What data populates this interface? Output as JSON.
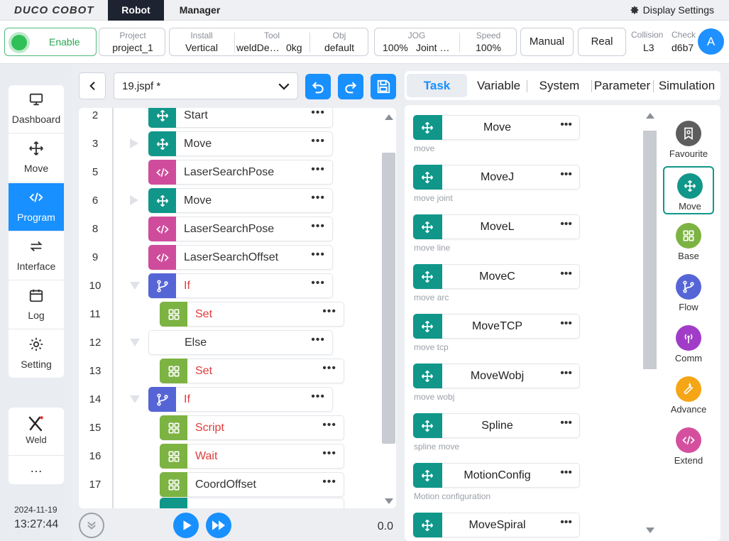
{
  "app": {
    "logo": "DUCO COBOT",
    "tabs": [
      "Robot",
      "Manager"
    ],
    "display_settings": "Display Settings"
  },
  "status": {
    "enable": "Enable",
    "project": {
      "caption": "Project",
      "value": "project_1"
    },
    "install": {
      "caption": "Install",
      "value": "Vertical"
    },
    "tool": {
      "caption": "Tool",
      "value": "weldDe…",
      "weight": "0kg"
    },
    "obj": {
      "caption": "Obj",
      "value": "default"
    },
    "jog": {
      "caption": "JOG",
      "percent": "100%",
      "mode": "Joint …"
    },
    "speed": {
      "caption": "Speed",
      "value": "100%"
    },
    "manual": "Manual",
    "real": "Real",
    "collision": {
      "caption": "Collision",
      "value": "L3"
    },
    "check": {
      "caption": "Check",
      "value": "d6b7"
    },
    "avatar": "A"
  },
  "sidebar": {
    "items": [
      {
        "label": "Dashboard",
        "icon": "monitor-icon"
      },
      {
        "label": "Move",
        "icon": "move-icon"
      },
      {
        "label": "Program",
        "icon": "code-icon"
      },
      {
        "label": "Interface",
        "icon": "swap-icon"
      },
      {
        "label": "Log",
        "icon": "calendar-icon"
      },
      {
        "label": "Setting",
        "icon": "gear-icon"
      }
    ],
    "active": "Program",
    "weld": "Weld",
    "more": "…"
  },
  "clock": {
    "date": "2024-11-19",
    "time": "13:27:44"
  },
  "program": {
    "file": "19.jspf *",
    "speed_value": "0.0",
    "rows": [
      {
        "line": "2",
        "label": "Start",
        "type": "move",
        "indent": 0,
        "arrow": "",
        "red": false
      },
      {
        "line": "3",
        "label": "Move",
        "type": "move",
        "indent": 0,
        "arrow": "right",
        "red": false
      },
      {
        "line": "5",
        "label": "LaserSearchPose",
        "type": "extend",
        "indent": 0,
        "arrow": "",
        "red": false
      },
      {
        "line": "6",
        "label": "Move",
        "type": "move",
        "indent": 0,
        "arrow": "right",
        "red": false
      },
      {
        "line": "8",
        "label": "LaserSearchPose",
        "type": "extend",
        "indent": 0,
        "arrow": "",
        "red": false
      },
      {
        "line": "9",
        "label": "LaserSearchOffset",
        "type": "extend",
        "indent": 0,
        "arrow": "",
        "red": false
      },
      {
        "line": "10",
        "label": "If",
        "type": "flow",
        "indent": 0,
        "arrow": "down",
        "red": true
      },
      {
        "line": "11",
        "label": "Set",
        "type": "base",
        "indent": 1,
        "arrow": "",
        "red": true
      },
      {
        "line": "12",
        "label": "Else",
        "type": "none",
        "indent": 0,
        "arrow": "down",
        "red": false
      },
      {
        "line": "13",
        "label": "Set",
        "type": "base",
        "indent": 1,
        "arrow": "",
        "red": true
      },
      {
        "line": "14",
        "label": "If",
        "type": "flow",
        "indent": 0,
        "arrow": "down",
        "red": true
      },
      {
        "line": "15",
        "label": "Script",
        "type": "base",
        "indent": 1,
        "arrow": "",
        "red": true
      },
      {
        "line": "16",
        "label": "Wait",
        "type": "base",
        "indent": 1,
        "arrow": "",
        "red": true
      },
      {
        "line": "17",
        "label": "CoordOffset",
        "type": "base",
        "indent": 1,
        "arrow": "",
        "red": false
      }
    ]
  },
  "right": {
    "tabs": [
      "Task",
      "Variable",
      "System",
      "Parameter",
      "Simulation"
    ],
    "active_tab": "Task",
    "commands": [
      {
        "label": "Move",
        "desc": "move"
      },
      {
        "label": "MoveJ",
        "desc": "move joint"
      },
      {
        "label": "MoveL",
        "desc": "move line"
      },
      {
        "label": "MoveC",
        "desc": "move arc"
      },
      {
        "label": "MoveTCP",
        "desc": "move tcp"
      },
      {
        "label": "MoveWobj",
        "desc": "move wobj"
      },
      {
        "label": "Spline",
        "desc": "spline move"
      },
      {
        "label": "MotionConfig",
        "desc": "Motion configuration"
      },
      {
        "label": "MoveSpiral",
        "desc": ""
      }
    ],
    "categories": [
      {
        "label": "Favourite",
        "color": "#5d5d5d"
      },
      {
        "label": "Move",
        "color": "#10978a"
      },
      {
        "label": "Base",
        "color": "#7cb342"
      },
      {
        "label": "Flow",
        "color": "#5665d6"
      },
      {
        "label": "Comm",
        "color": "#a03cc8"
      },
      {
        "label": "Advance",
        "color": "#f5a516"
      },
      {
        "label": "Extend",
        "color": "#d4509f"
      }
    ],
    "active_category": "Move"
  },
  "colors": {
    "accent": "#1890ff",
    "move": "#10978a",
    "base": "#7cb342",
    "flow": "#5665d6",
    "extend": "#cf4c9c",
    "enable": "#31c057",
    "error_text": "#e03a3a"
  }
}
